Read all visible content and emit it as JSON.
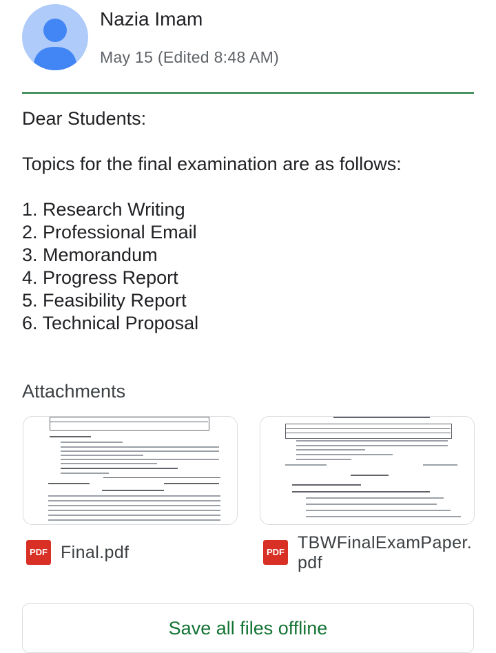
{
  "post": {
    "author": "Nazia Imam",
    "meta": "May 15 (Edited 8:48 AM)"
  },
  "message": {
    "greeting": "Dear Students:",
    "intro": "Topics for the final examination are as follows:",
    "topics": [
      "1. Research Writing",
      "2. Professional Email",
      "3. Memorandum",
      "4. Progress Report",
      "5. Feasibility Report",
      "6. Technical Proposal"
    ]
  },
  "attachments": {
    "title": "Attachments",
    "files": [
      {
        "name": "Final.pdf",
        "icon": "pdf-icon",
        "icon_label": "PDF"
      },
      {
        "name_line1": "TBWFinalExamPaper.",
        "name_line2": "pdf",
        "icon": "pdf-icon",
        "icon_label": "PDF"
      }
    ]
  },
  "actions": {
    "save_offline": "Save all files offline"
  },
  "colors": {
    "accent": "#137333",
    "avatar_bg": "#aecbfa",
    "avatar_fg": "#4285f4",
    "pdf": "#d93025"
  }
}
